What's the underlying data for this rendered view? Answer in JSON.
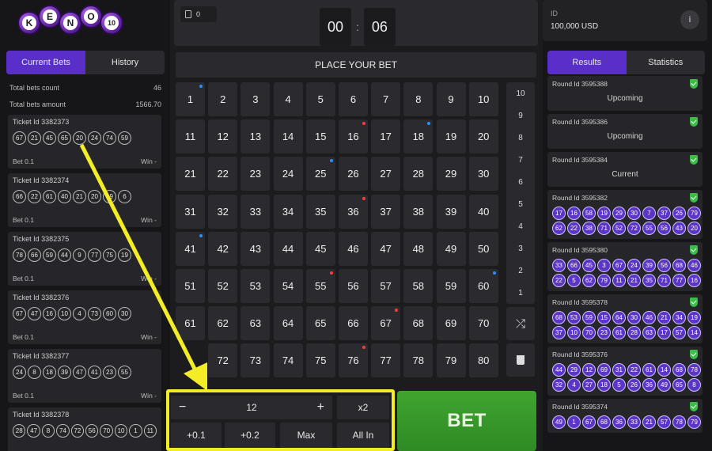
{
  "logo": {
    "letters": [
      "K",
      "E",
      "N",
      "O",
      "10"
    ]
  },
  "left": {
    "tabs": [
      {
        "label": "Current Bets",
        "active": true
      },
      {
        "label": "History",
        "active": false
      }
    ],
    "stats": [
      {
        "label": "Total bets count",
        "value": "46"
      },
      {
        "label": "Total bets amount",
        "value": "1566.70"
      }
    ],
    "tickets": [
      {
        "id": "Ticket Id 3382373",
        "numbers": [
          "67",
          "21",
          "45",
          "65",
          "20",
          "24",
          "74",
          "59"
        ],
        "bet": "Bet 0.1",
        "win": "Win -"
      },
      {
        "id": "Ticket Id 3382374",
        "numbers": [
          "66",
          "22",
          "61",
          "40",
          "21",
          "20",
          "19",
          "6"
        ],
        "bet": "Bet 0.1",
        "win": "Win -"
      },
      {
        "id": "Ticket Id 3382375",
        "numbers": [
          "78",
          "66",
          "59",
          "44",
          "9",
          "77",
          "75",
          "19"
        ],
        "bet": "Bet 0.1",
        "win": "Win -"
      },
      {
        "id": "Ticket Id 3382376",
        "numbers": [
          "67",
          "47",
          "16",
          "10",
          "4",
          "73",
          "60",
          "30"
        ],
        "bet": "Bet 0.1",
        "win": "Win -"
      },
      {
        "id": "Ticket Id 3382377",
        "numbers": [
          "24",
          "8",
          "18",
          "39",
          "47",
          "41",
          "23",
          "55"
        ],
        "bet": "Bet 0.1",
        "win": "Win -"
      },
      {
        "id": "Ticket Id 3382378",
        "numbers": [
          "28",
          "47",
          "8",
          "74",
          "72",
          "56",
          "70",
          "10",
          "1",
          "11"
        ],
        "bet": "",
        "win": ""
      }
    ]
  },
  "center": {
    "bets_count": "0",
    "timer": {
      "minutes": "00",
      "separator": ":",
      "seconds": "06"
    },
    "place_bet": "PLACE YOUR BET",
    "numbers": [
      "1",
      "2",
      "3",
      "4",
      "5",
      "6",
      "7",
      "8",
      "9",
      "10",
      "11",
      "12",
      "13",
      "14",
      "15",
      "16",
      "17",
      "18",
      "19",
      "20",
      "21",
      "22",
      "23",
      "24",
      "25",
      "26",
      "27",
      "28",
      "29",
      "30",
      "31",
      "32",
      "33",
      "34",
      "35",
      "36",
      "37",
      "38",
      "39",
      "40",
      "41",
      "42",
      "43",
      "44",
      "45",
      "46",
      "47",
      "48",
      "49",
      "50",
      "51",
      "52",
      "53",
      "54",
      "55",
      "56",
      "57",
      "58",
      "59",
      "60",
      "61",
      "62",
      "63",
      "64",
      "65",
      "66",
      "67",
      "68",
      "69",
      "70",
      "",
      "72",
      "73",
      "74",
      "75",
      "76",
      "77",
      "78",
      "79",
      "80"
    ],
    "dots": {
      "1": "#2f8cff",
      "16": "#ff3b3b",
      "18": "#2f8cff",
      "25": "#2f8cff",
      "36": "#ff3b3b",
      "41": "#2f8cff",
      "55": "#ff3b3b",
      "60": "#2f8cff",
      "67": "#ff3b3b",
      "76": "#ff3b3b"
    },
    "picks": [
      "10",
      "9",
      "8",
      "7",
      "6",
      "5",
      "4",
      "3",
      "2",
      "1"
    ],
    "stake": {
      "minus": "−",
      "value": "12",
      "plus": "+",
      "multiplier": "x2",
      "quick": [
        "+0.1",
        "+0.2",
        "Max",
        "All In"
      ]
    },
    "bet_label": "BET"
  },
  "right": {
    "id_label": "ID",
    "balance": "100,000 USD",
    "info": "i",
    "tabs": [
      {
        "label": "Results",
        "active": true
      },
      {
        "label": "Statistics",
        "active": false
      }
    ],
    "rounds": [
      {
        "id": "Round Id 3595388",
        "status": "Upcoming",
        "balls": []
      },
      {
        "id": "Round Id 3595386",
        "status": "Upcoming",
        "balls": []
      },
      {
        "id": "Round Id 3595384",
        "status": "Current",
        "balls": []
      },
      {
        "id": "Round Id 3595382",
        "status": "",
        "balls": [
          "17",
          "16",
          "58",
          "19",
          "29",
          "30",
          "7",
          "37",
          "26",
          "79",
          "62",
          "22",
          "38",
          "71",
          "52",
          "72",
          "55",
          "56",
          "43",
          "20"
        ]
      },
      {
        "id": "Round Id 3595380",
        "status": "",
        "balls": [
          "33",
          "66",
          "45",
          "3",
          "67",
          "24",
          "39",
          "56",
          "68",
          "46",
          "22",
          "5",
          "62",
          "79",
          "11",
          "21",
          "35",
          "71",
          "77",
          "16"
        ]
      },
      {
        "id": "Round Id 3595378",
        "status": "",
        "balls": [
          "68",
          "53",
          "59",
          "15",
          "64",
          "30",
          "46",
          "21",
          "34",
          "19",
          "37",
          "10",
          "70",
          "23",
          "61",
          "28",
          "63",
          "17",
          "57",
          "14"
        ]
      },
      {
        "id": "Round Id 3595376",
        "status": "",
        "balls": [
          "44",
          "29",
          "12",
          "69",
          "31",
          "22",
          "61",
          "14",
          "68",
          "78",
          "32",
          "4",
          "27",
          "18",
          "5",
          "26",
          "36",
          "49",
          "65",
          "8"
        ]
      },
      {
        "id": "Round Id 3595374",
        "status": "",
        "balls": [
          "49",
          "1",
          "67",
          "68",
          "36",
          "33",
          "21",
          "57",
          "78",
          "79"
        ]
      }
    ]
  },
  "colors": {
    "accent": "#5a2fc9",
    "bet_green": "#3a9a2b",
    "highlight_yellow": "#f4ec27",
    "ball_purple": "#5a35c7"
  }
}
